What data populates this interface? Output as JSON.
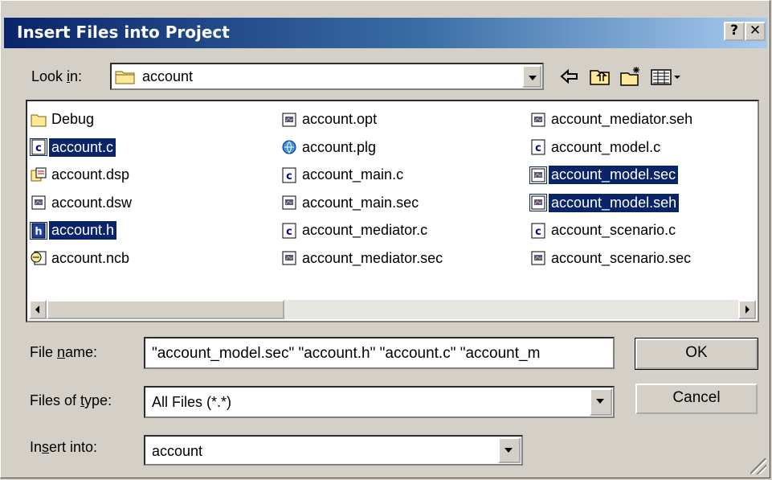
{
  "window": {
    "title": "Insert Files into Project",
    "help_label": "?",
    "close_label": "✕"
  },
  "look_in": {
    "label": "Look in:",
    "value": "account"
  },
  "toolbar": {
    "icons": [
      "back-arrow-icon",
      "up-folder-icon",
      "new-folder-icon",
      "view-menu-icon"
    ]
  },
  "files": [
    {
      "name": "Debug",
      "icon": "folder-icon",
      "selected": false
    },
    {
      "name": "account.c",
      "icon": "c-source-icon",
      "selected": true
    },
    {
      "name": "account.dsp",
      "icon": "project-icon",
      "selected": false
    },
    {
      "name": "account.dsw",
      "icon": "generic-file-icon",
      "selected": false
    },
    {
      "name": "account.h",
      "icon": "header-file-icon",
      "selected": true
    },
    {
      "name": "account.ncb",
      "icon": "database-file-icon",
      "selected": false
    },
    {
      "name": "account.opt",
      "icon": "generic-file-icon",
      "selected": false
    },
    {
      "name": "account.plg",
      "icon": "html-file-icon",
      "selected": false
    },
    {
      "name": "account_main.c",
      "icon": "c-source-icon",
      "selected": false
    },
    {
      "name": "account_main.sec",
      "icon": "generic-file-icon",
      "selected": false
    },
    {
      "name": "account_mediator.c",
      "icon": "c-source-icon",
      "selected": false
    },
    {
      "name": "account_mediator.sec",
      "icon": "generic-file-icon",
      "selected": false
    },
    {
      "name": "account_mediator.seh",
      "icon": "generic-file-icon",
      "selected": false
    },
    {
      "name": "account_model.c",
      "icon": "c-source-icon",
      "selected": false
    },
    {
      "name": "account_model.sec",
      "icon": "generic-file-icon",
      "selected": true
    },
    {
      "name": "account_model.seh",
      "icon": "generic-file-icon",
      "selected": true
    },
    {
      "name": "account_scenario.c",
      "icon": "c-source-icon",
      "selected": false
    },
    {
      "name": "account_scenario.sec",
      "icon": "generic-file-icon",
      "selected": false
    }
  ],
  "file_name": {
    "label": "File name:",
    "value": "\"account_model.sec\" \"account.h\" \"account.c\" \"account_m"
  },
  "files_of_type": {
    "label": "Files of type:",
    "value": "All Files (*.*)"
  },
  "insert_into": {
    "label": "Insert into:",
    "value": "account"
  },
  "buttons": {
    "ok": "OK",
    "cancel": "Cancel"
  }
}
